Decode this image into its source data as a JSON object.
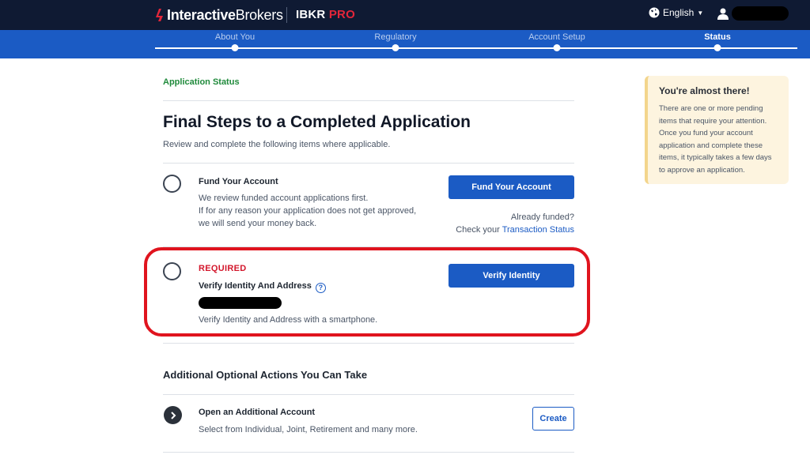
{
  "header": {
    "brand_bold": "Interactive",
    "brand_rest": "Brokers",
    "product_main": "IBKR",
    "product_accent": "PRO",
    "language": "English",
    "icons": {
      "globe": "globe-icon",
      "caret": "caret-down-icon",
      "user": "user-icon"
    },
    "colors": {
      "background": "#0f1a33",
      "accent": "#e2263a"
    }
  },
  "steps": [
    {
      "label": "About You",
      "active": false
    },
    {
      "label": "Regulatory",
      "active": false
    },
    {
      "label": "Account Setup",
      "active": false
    },
    {
      "label": "Status",
      "active": true
    }
  ],
  "main": {
    "breadcrumb": "Application Status",
    "title": "Final Steps to a Completed Application",
    "subtitle": "Review and complete the following items where applicable.",
    "fund_item": {
      "title": "Fund Your Account",
      "line1": "We review funded account applications first.",
      "line2": "If for any reason your application does not get approved,",
      "line3": "we will send your money back.",
      "button": "Fund Your Account",
      "already_funded": "Already funded?",
      "check_prefix": "Check your",
      "check_link": "Transaction Status"
    },
    "verify_item": {
      "required_label": "REQUIRED",
      "title": "Verify Identity And Address",
      "help": "?",
      "description": "Verify Identity and Address with a smartphone.",
      "button": "Verify Identity"
    },
    "optional_section": {
      "title": "Additional Optional Actions You Can Take",
      "item_title": "Open an Additional Account",
      "item_text": "Select from Individual, Joint, Retirement and many more.",
      "button": "Create"
    }
  },
  "side_card": {
    "title": "You're almost there!",
    "text": "There are one or more pending items that require your attention. Once you fund your account application and complete these items, it typically takes a few days to approve an application."
  },
  "colors": {
    "primary": "#1b5bc4",
    "required": "#d3172c",
    "breadcrumb": "#1f8a3b",
    "highlight": "#e0141e",
    "card_background": "#fdf4df"
  }
}
